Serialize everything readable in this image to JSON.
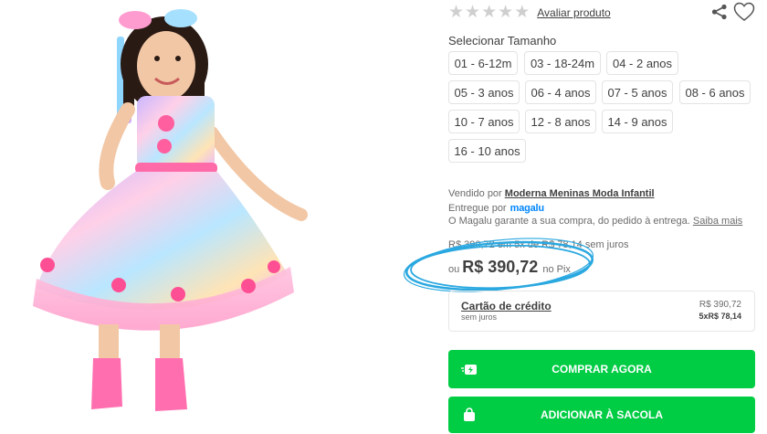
{
  "rating": {
    "stars_filled": 0,
    "stars_total": 5,
    "review_link": "Avaliar produto"
  },
  "icons": {
    "share": "share-icon",
    "favorite": "heart-icon",
    "star": "star-icon",
    "buy": "cart-lightning-icon",
    "bag": "shopping-bag-icon"
  },
  "size_selector": {
    "title": "Selecionar Tamanho",
    "options": [
      "01 - 6-12m",
      "03 - 18-24m",
      "04 - 2 anos",
      "05 - 3 anos",
      "06 - 4 anos",
      "07 - 5 anos",
      "08 - 6 anos",
      "10 - 7 anos",
      "12 - 8 anos",
      "14 - 9 anos",
      "16 - 10 anos"
    ]
  },
  "seller": {
    "prefix": "Vendido por",
    "name": "Moderna Meninas Moda Infantil",
    "delivery_prefix": "Entregue por",
    "delivery_brand": "magalu",
    "guarantee": "O Magalu garante a sua compra, do pedido à entrega.",
    "guarantee_link": "Saiba mais"
  },
  "pricing": {
    "installments_text": "R$ 390,72 em 5x de R$ 78,14 sem juros",
    "pix_prefix": "ou",
    "pix_price": "R$ 390,72",
    "pix_suffix": "no Pix"
  },
  "payment": {
    "method": "Cartão de crédito",
    "note": "sem juros",
    "total": "R$ 390,72",
    "installments": "5xR$ 78,14"
  },
  "actions": {
    "buy_now": "COMPRAR AGORA",
    "add_to_bag": "ADICIONAR À SACOLA"
  },
  "colors": {
    "accent_green": "#00cc44",
    "highlight_ring": "#2aa8e0",
    "magalu_blue": "#0086ff"
  }
}
